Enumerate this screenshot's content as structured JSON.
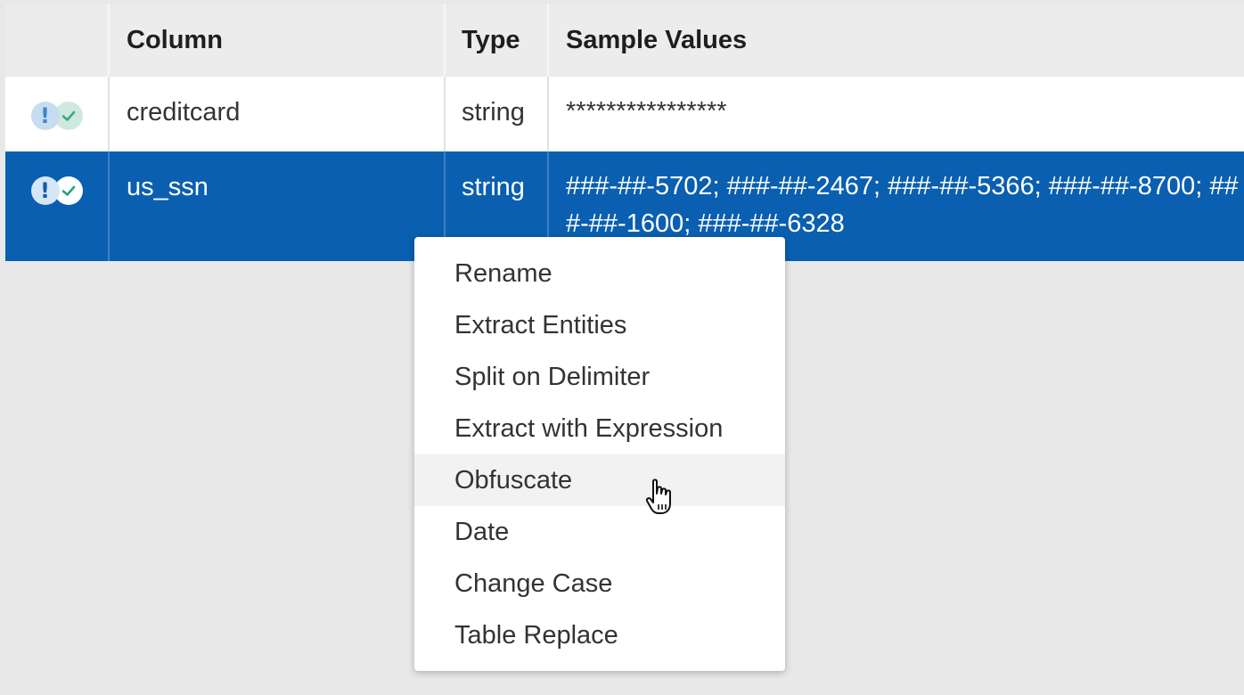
{
  "header": {
    "column_label": "Column",
    "type_label": "Type",
    "sample_label": "Sample Values"
  },
  "rows": [
    {
      "icons": [
        "exclamation-icon",
        "check-icon"
      ],
      "column": "creditcard",
      "type": "string",
      "sample": "****************"
    },
    {
      "icons": [
        "exclamation-icon",
        "check-icon"
      ],
      "column": "us_ssn",
      "type": "string",
      "sample": "###-##-5702; ###-##-2467; ###-##-5366; ###-##-8700; ###-##-1600; ###-##-6328",
      "selected": true
    }
  ],
  "context_menu": {
    "items": [
      "Rename",
      "Extract Entities",
      "Split on Delimiter",
      "Extract with Expression",
      "Obfuscate",
      "Date",
      "Change Case",
      "Table Replace"
    ],
    "hovered": "Obfuscate"
  },
  "colors": {
    "selected_row": "#0a5fb0",
    "background": "#e8e8e8",
    "warn_icon": "#3d86cf",
    "ok_icon": "#2aa080"
  }
}
